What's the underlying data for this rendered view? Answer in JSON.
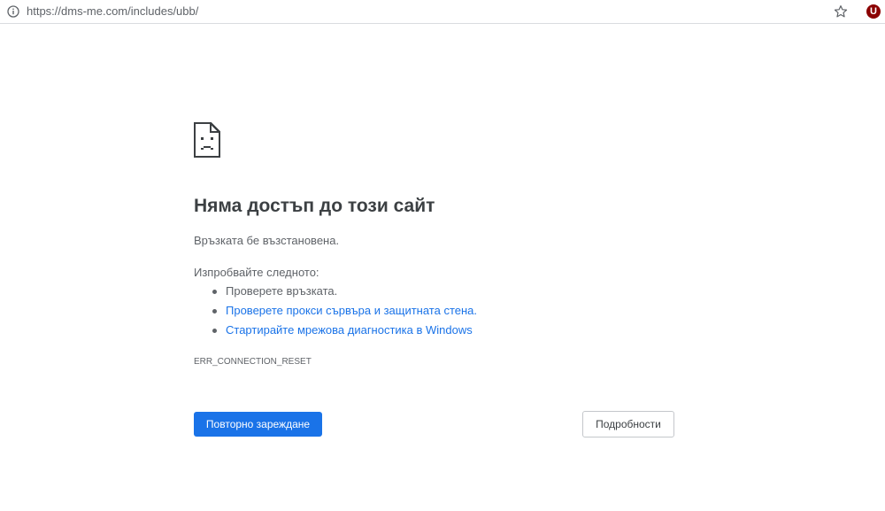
{
  "browser": {
    "url": "https://dms-me.com/includes/ubb/",
    "extension_badge": "U"
  },
  "icons": {
    "info": "info-icon",
    "bookmark": "star-icon",
    "page": "sad-document-icon"
  },
  "error": {
    "title": "Няма достъп до този сайт",
    "message": "Връзката бе възстановена.",
    "try_label": "Изпробвайте следното:",
    "suggestions": [
      {
        "text": "Проверете връзката.",
        "is_link": false
      },
      {
        "text": "Проверете прокси сървъра и защитната стена.",
        "is_link": true
      },
      {
        "text": "Стартирайте мрежова диагностика в Windows",
        "is_link": true
      }
    ],
    "code": "ERR_CONNECTION_RESET",
    "reload_label": "Повторно зареждане",
    "details_label": "Подробности"
  },
  "colors": {
    "link": "#1a73e8",
    "button_primary": "#1a73e8",
    "text": "#5f6368",
    "heading": "#3c4043",
    "extension": "#8b0000"
  }
}
